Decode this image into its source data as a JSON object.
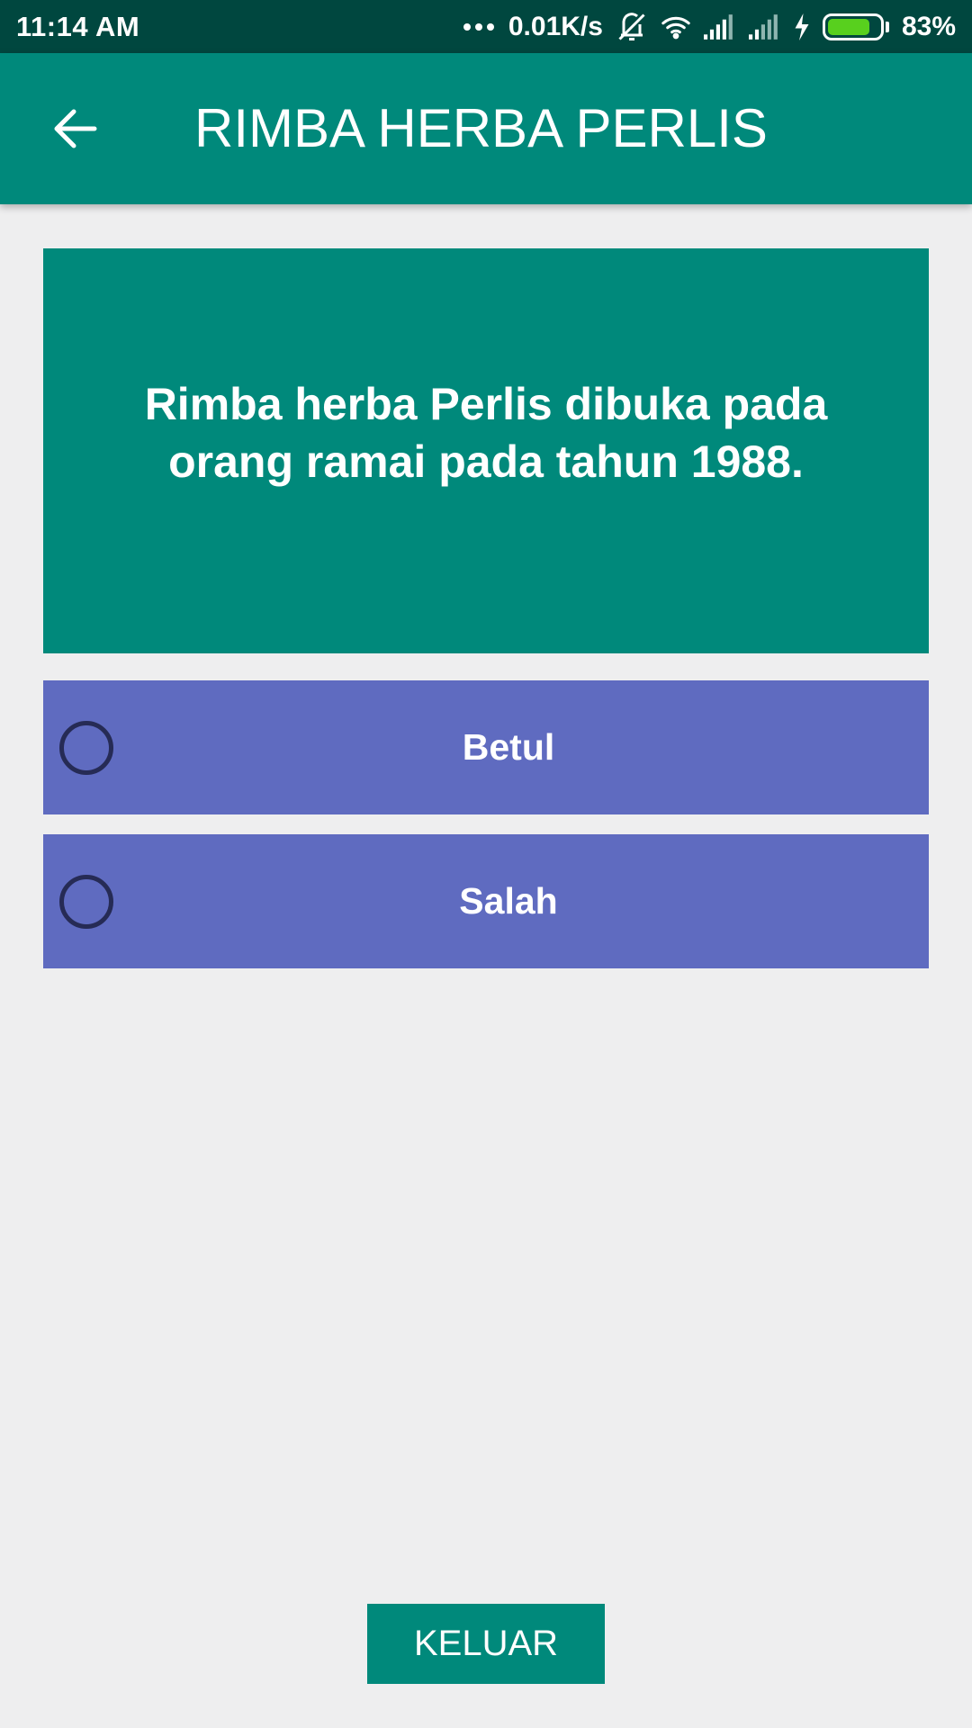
{
  "status_bar": {
    "time": "11:14 AM",
    "net_speed": "0.01K/s",
    "battery_percent": "83%",
    "battery_level": 0.83,
    "icons": [
      "more-dots-icon",
      "vibrate-off-icon",
      "wifi-icon",
      "signal-icon",
      "signal-weak-icon",
      "charging-icon",
      "battery-icon"
    ]
  },
  "app_bar": {
    "title": "RIMBA HERBA PERLIS",
    "back_icon": "back-arrow-icon"
  },
  "quiz": {
    "question": "Rimba herba Perlis dibuka pada orang ramai pada tahun 1988.",
    "options": [
      {
        "label": "Betul",
        "selected": false
      },
      {
        "label": "Salah",
        "selected": false
      }
    ]
  },
  "footer": {
    "exit_label": "KELUAR"
  },
  "colors": {
    "status_bar": "#00473f",
    "primary": "#00897b",
    "option": "#5f6bc0",
    "radio": "#262b55",
    "background": "#eeeeef",
    "battery": "#58d01e"
  }
}
